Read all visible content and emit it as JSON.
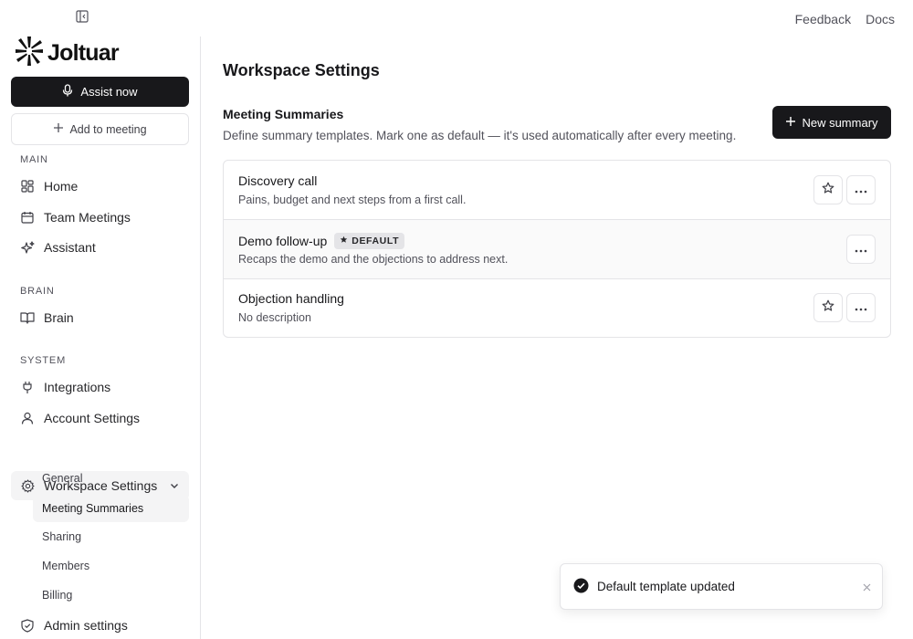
{
  "topbar": {
    "feedback": "Feedback",
    "docs": "Docs"
  },
  "brand": {
    "name": "Joltuar"
  },
  "sidebar": {
    "assist_label": "Assist now",
    "add_label": "Add to meeting",
    "sections": {
      "main": "MAIN",
      "brain": "BRAIN",
      "system": "SYSTEM"
    },
    "items": {
      "home": "Home",
      "team_meetings": "Team Meetings",
      "assistant": "Assistant",
      "brain": "Brain",
      "integrations": "Integrations",
      "account_settings": "Account Settings",
      "workspace_settings": "Workspace Settings",
      "admin_settings": "Admin settings"
    },
    "sub_items": {
      "general": "General",
      "meeting_summaries": "Meeting Summaries",
      "sharing": "Sharing",
      "members": "Members",
      "billing": "Billing"
    }
  },
  "main": {
    "page_title": "Workspace Settings",
    "section_title": "Meeting Summaries",
    "section_desc": "Define summary templates. Mark one as default — it's used automatically after every meeting.",
    "new_button": "New summary",
    "templates": [
      {
        "name": "Discovery call",
        "desc": "Pains, budget and next steps from a first call.",
        "is_default": false
      },
      {
        "name": "Demo follow-up",
        "desc": "Recaps the demo and the objections to address next.",
        "is_default": true,
        "badge": "DEFAULT"
      },
      {
        "name": "Objection handling",
        "desc": "No description",
        "is_default": false
      }
    ]
  },
  "toast": {
    "message": "Default template updated"
  }
}
